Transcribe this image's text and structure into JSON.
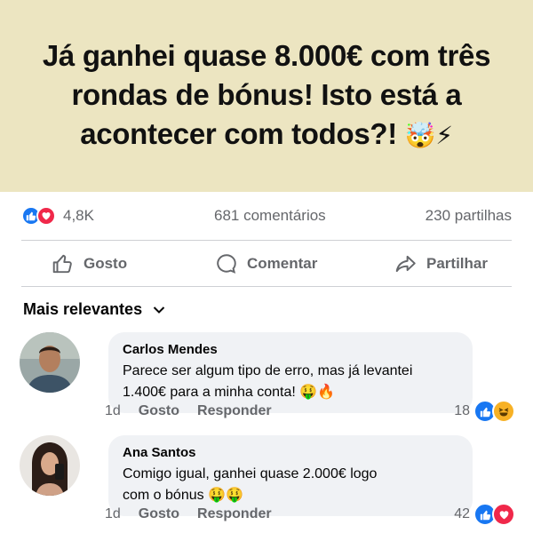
{
  "banner": {
    "line1": "Já ganhei quase 8.000€ com três",
    "line2": "rondas de bónus! Isto está a",
    "line3": "acontecer com todos?!",
    "emoji": "🤯⚡"
  },
  "stats": {
    "reactions": [
      "like-icon",
      "love-icon"
    ],
    "reaction_count": "4,8K",
    "comments": "681 comentários",
    "shares": "230 partilhas"
  },
  "actions": {
    "like": "Gosto",
    "comment": "Comentar",
    "share": "Partilhar"
  },
  "sort": {
    "label": "Mais relevantes"
  },
  "comments": [
    {
      "name": "Carlos Mendes",
      "line1": "Parece ser algum tipo de erro, mas já levantei",
      "line2": "1.400€ para a minha conta! 🤑🔥",
      "time": "1d",
      "like": "Gosto",
      "reply": "Responder",
      "reaction_count": "18",
      "reactions": [
        "like-icon",
        "haha-icon"
      ]
    },
    {
      "name": "Ana Santos",
      "line1": "Comigo igual, ganhei quase 2.000€ logo",
      "line2": "com o bónus 🤑🤑",
      "time": "1d",
      "like": "Gosto",
      "reply": "Responder",
      "reaction_count": "42",
      "reactions": [
        "like-icon",
        "love-icon"
      ]
    }
  ],
  "colors": {
    "banner_bg": "#ece5c1",
    "like_blue": "#1877f2",
    "love_red": "#f0284a",
    "haha_yellow": "#f7b125",
    "muted": "#65676b"
  }
}
